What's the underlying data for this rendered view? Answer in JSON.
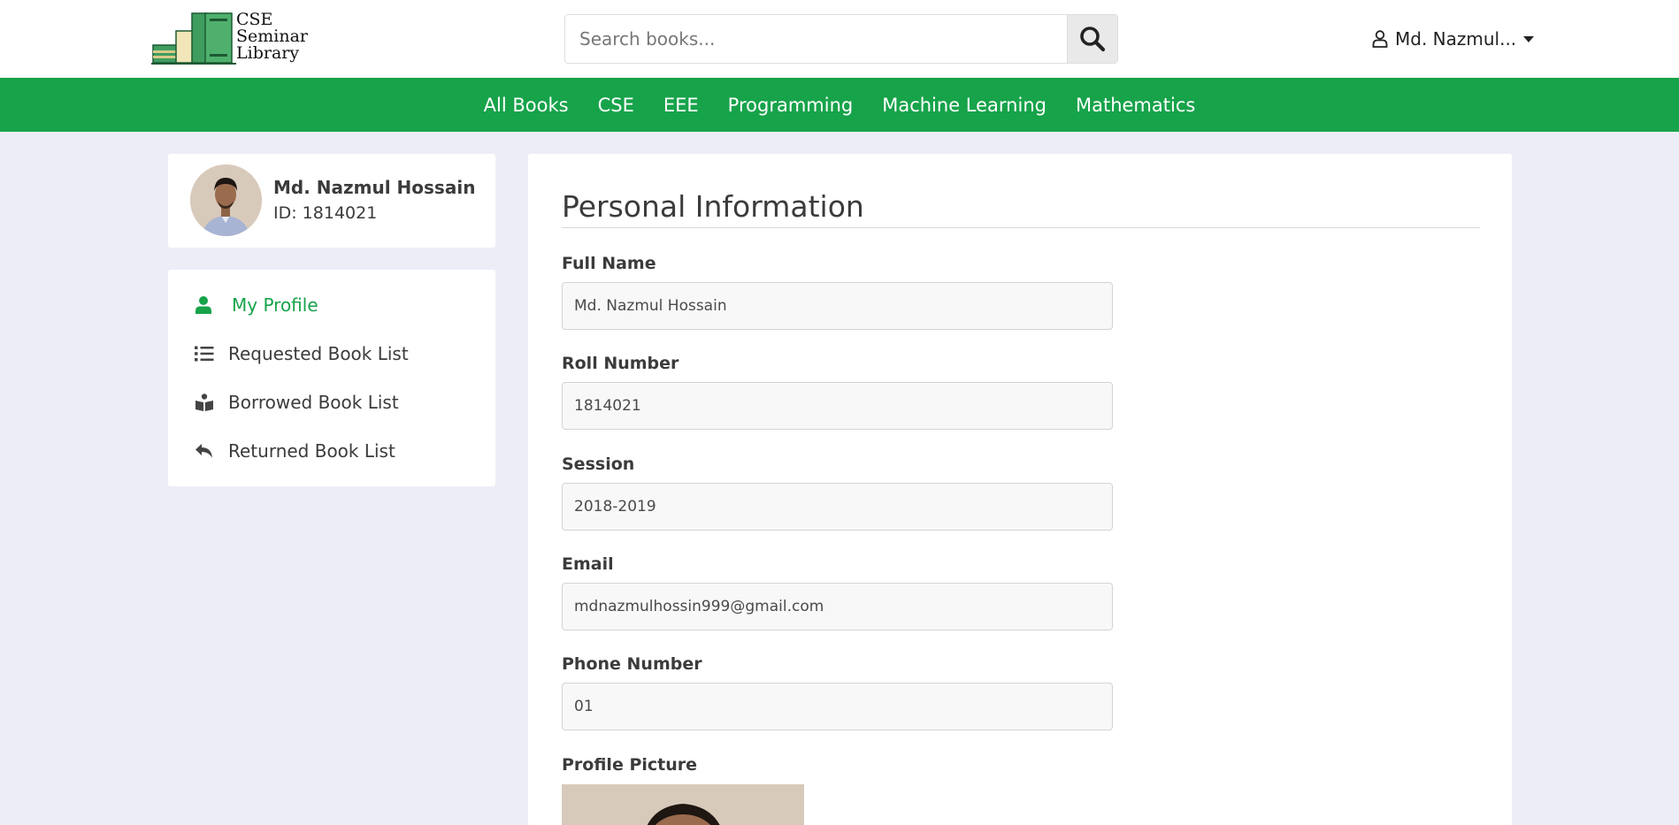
{
  "header": {
    "logo_text": [
      "CSE",
      "Seminar",
      "Library"
    ],
    "search_placeholder": "Search books...",
    "user_name": "Md. Nazmul..."
  },
  "categories": [
    "All Books",
    "CSE",
    "EEE",
    "Programming",
    "Machine Learning",
    "Mathematics"
  ],
  "profile": {
    "name": "Md. Nazmul Hossain",
    "id_text": "ID: 1814021"
  },
  "menu": [
    {
      "label": "My Profile",
      "icon": "user-icon",
      "active": true
    },
    {
      "label": "Requested Book List",
      "icon": "list-icon",
      "active": false
    },
    {
      "label": "Borrowed Book List",
      "icon": "book-reader-icon",
      "active": false
    },
    {
      "label": "Returned Book List",
      "icon": "reply-icon",
      "active": false
    }
  ],
  "personal_info": {
    "title": "Personal Information",
    "fields": [
      {
        "label": "Full Name",
        "value": "Md. Nazmul Hossain"
      },
      {
        "label": "Roll Number",
        "value": "1814021"
      },
      {
        "label": "Session",
        "value": "2018-2019"
      },
      {
        "label": "Email",
        "value": "mdnazmulhossin999@gmail.com"
      },
      {
        "label": "Phone Number",
        "value": "01"
      }
    ],
    "picture_label": "Profile Picture"
  },
  "colors": {
    "brand_green": "#17a34a",
    "page_bg": "#ededf8"
  }
}
